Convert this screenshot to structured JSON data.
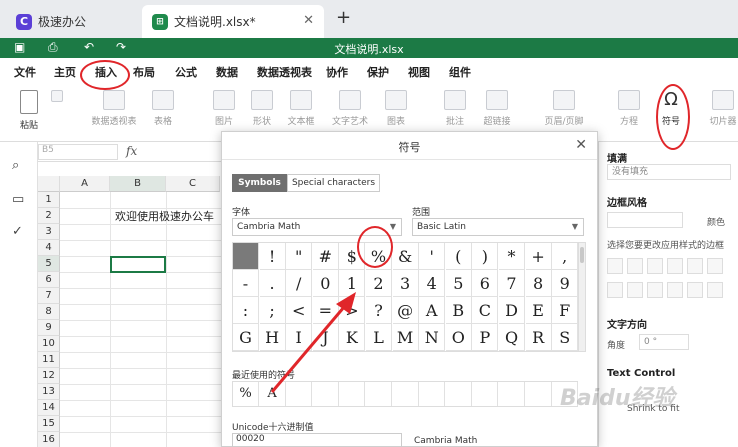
{
  "tabs": [
    {
      "label": "极速办公",
      "icon": "C"
    },
    {
      "label": "文档说明.xlsx*",
      "icon": "⊞"
    }
  ],
  "document_title": "文档说明.xlsx",
  "menu": [
    "文件",
    "主页",
    "插入",
    "布局",
    "公式",
    "数据",
    "数据透视表",
    "协作",
    "保护",
    "视图",
    "组件"
  ],
  "ribbon": {
    "paste": "粘贴",
    "pivot_table": "数据透视表",
    "table": "表格",
    "image": "图片",
    "shape": "形状",
    "textbox": "文本框",
    "textart": "文字艺术",
    "chart": "图表",
    "comment": "批注",
    "hyperlink": "超链接",
    "header_footer": "页眉/页脚",
    "equation": "方程",
    "symbol": "符号",
    "slicer": "切片器"
  },
  "formula_bar": {
    "name_box": "B5",
    "fx": "fx"
  },
  "sheet": {
    "columns": [
      "A",
      "B",
      "C"
    ],
    "rows": [
      "1",
      "2",
      "3",
      "4",
      "5",
      "6",
      "7",
      "8",
      "9",
      "10",
      "11",
      "12",
      "13",
      "14",
      "15",
      "16"
    ],
    "b2_text": "欢迎使用极速办公车"
  },
  "right_panel": {
    "fill_label": "填满",
    "fill_value": "没有填充",
    "border_label": "边框风格",
    "color_label": "颜色",
    "border_hint": "选择您要更改应用样式的边框",
    "text_dir_label": "文字方向",
    "angle_label": "角度",
    "angle_value": "0 °",
    "text_control": "Text Control",
    "shrink_label": "Shrink to fit"
  },
  "dialog": {
    "title": "符号",
    "tab_symbols": "Symbols",
    "tab_special": "Special characters",
    "font_label": "字体",
    "font_value": "Cambria Math",
    "range_label": "范围",
    "range_value": "Basic Latin",
    "symbols": [
      [
        "",
        "!",
        "\"",
        "#",
        "$",
        "%",
        "&",
        "'",
        "(",
        ")",
        "*",
        "+",
        ","
      ],
      [
        "-",
        ".",
        "/",
        "0",
        "1",
        "2",
        "3",
        "4",
        "5",
        "6",
        "7",
        "8",
        "9"
      ],
      [
        ":",
        ";",
        "<",
        "=",
        ">",
        "?",
        "@",
        "A",
        "B",
        "C",
        "D",
        "E",
        "F"
      ],
      [
        "G",
        "H",
        "I",
        "J",
        "K",
        "L",
        "M",
        "N",
        "O",
        "P",
        "Q",
        "R",
        "S"
      ]
    ],
    "recent_label": "最近使用的符号",
    "recent": [
      "%",
      "A"
    ],
    "unicode_label": "Unicode十六进制值",
    "unicode_value": "00020",
    "font_note": "Cambria Math"
  },
  "watermark": "Baidu经验",
  "colors": {
    "brand_green": "#1c7a45",
    "annotation_red": "#e0262a",
    "tab_purple": "#5b3fd6"
  }
}
